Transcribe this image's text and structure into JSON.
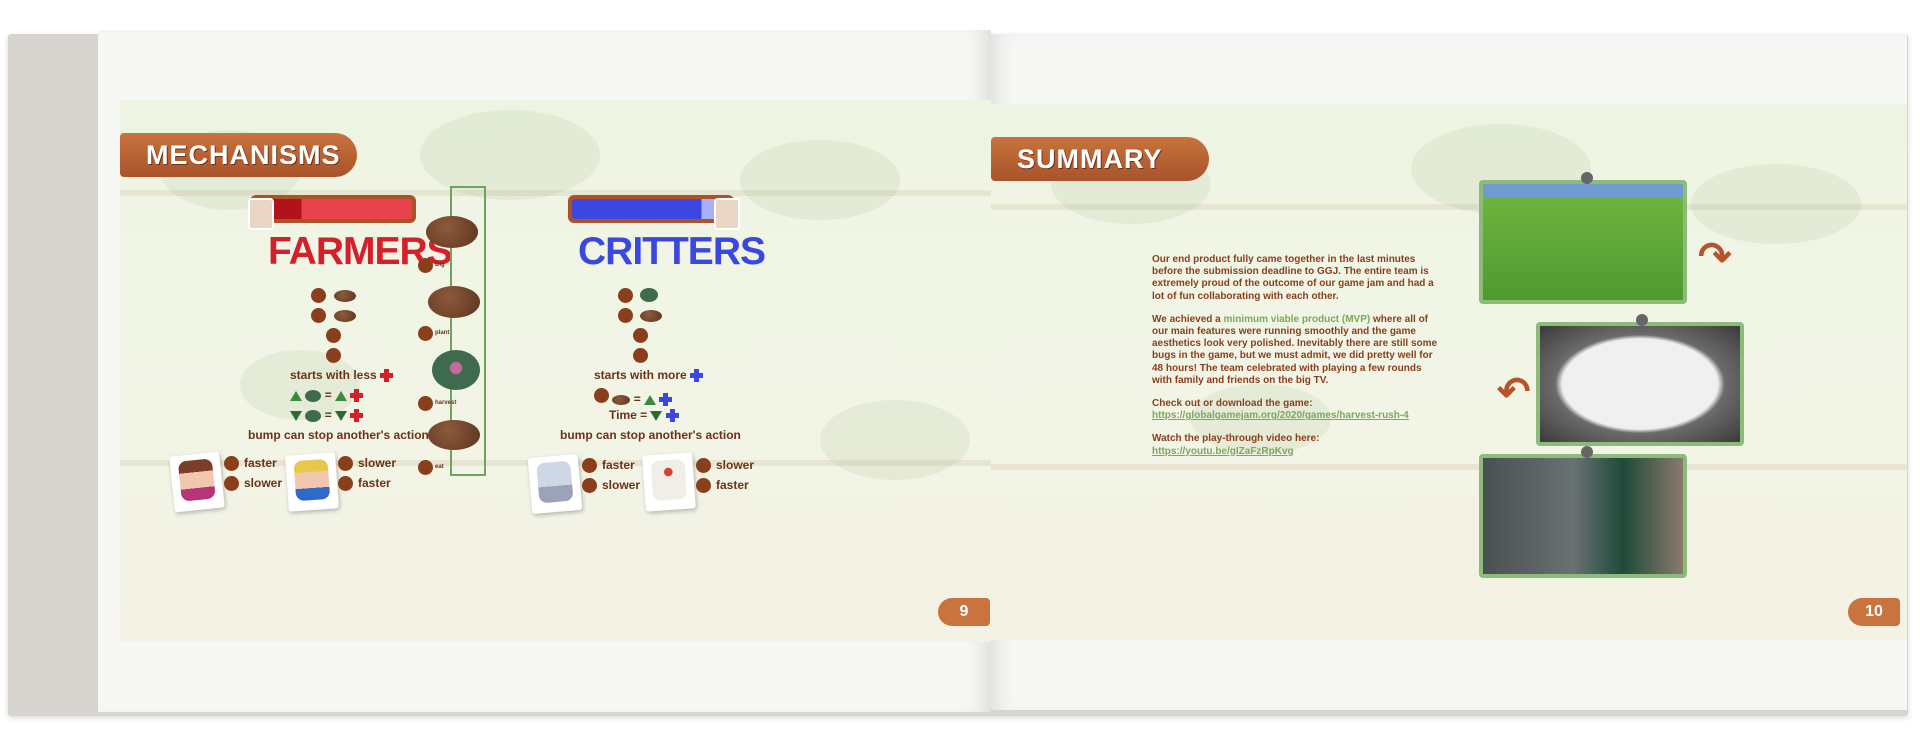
{
  "left_page": {
    "heading": "MECHANISMS",
    "farmers": {
      "title": "FARMERS",
      "color": "#d4202b",
      "starts": "starts with less",
      "eq": "=",
      "bump": "bump can stop another's action",
      "char1": {
        "a": "faster",
        "b": "slower"
      },
      "char2": {
        "a": "slower",
        "b": "faster"
      }
    },
    "critters": {
      "title": "CRITTERS",
      "color": "#3b47e0",
      "starts": "starts with more",
      "eq": "=",
      "time": "Time =",
      "bump": "bump can stop another's action",
      "char1": {
        "a": "faster",
        "b": "slower"
      },
      "char2": {
        "a": "slower",
        "b": "faster"
      }
    },
    "flow": {
      "dig": "Dig",
      "plant": "plant",
      "harvest": "harvest",
      "eat": "eat"
    },
    "page_number": "9"
  },
  "right_page": {
    "heading": "SUMMARY",
    "para1": "Our end product fully came together in the last minutes before the submission deadline to GGJ. The entire team is extremely proud of the outcome of our game jam and had a lot of fun collaborating with each other.",
    "para2_pre": "We achieved a ",
    "para2_highlight": "minimum viable product (MVP)",
    "para2_post": " where all of our main features were running smoothly and the game aesthetics look very polished. Inevitably there are still some bugs in the game, but we must admit, we did pretty well for 48 hours! The team celebrated with playing a few rounds with family and friends on the big TV.",
    "download_label": "Check out or download the game:",
    "download_url": "https://globalgamejam.org/2020/games/harvest-rush-4",
    "video_label": "Watch the play-through video here:",
    "video_url": "https://youtu.be/gIZaFzRpKvg",
    "page_number": "10"
  },
  "colors": {
    "wood": "#a8532a",
    "accent_green": "#7aa85c",
    "text_brown": "#8a3f1c"
  }
}
